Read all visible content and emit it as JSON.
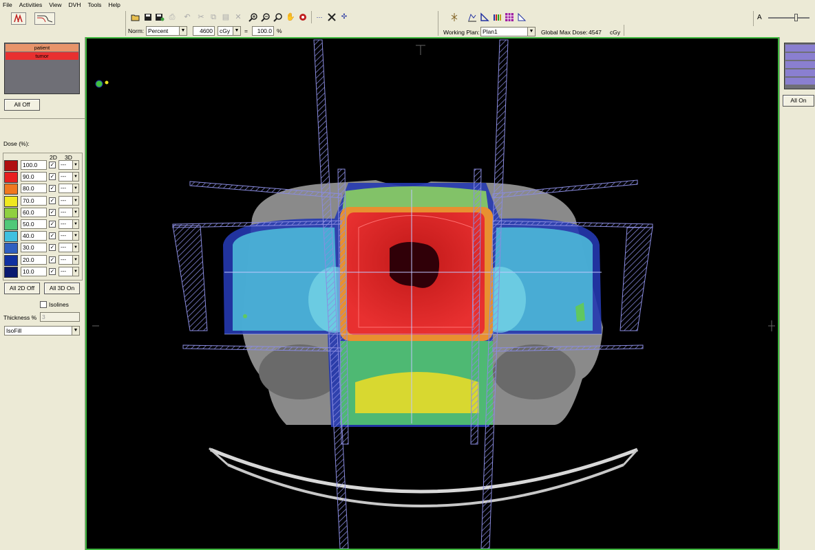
{
  "menu": [
    "File",
    "Activities",
    "View",
    "DVH",
    "Tools",
    "Help"
  ],
  "toolbar": {
    "norm_label": "Norm:",
    "norm_mode": "Percent",
    "norm_dose": "4600",
    "norm_unit": "cGy",
    "equals": "=",
    "norm_percent": "100.0",
    "percent_sign": "%",
    "working_plan_label": "Working Plan:",
    "working_plan": "Plan1",
    "global_max_label": "Global Max Dose:",
    "global_max_value": "4547",
    "global_max_unit": "cGy",
    "slider_label": "A"
  },
  "structures": {
    "items": [
      {
        "label": "patient",
        "color": "#e8946a"
      },
      {
        "label": "tumor",
        "color": "#e83030"
      }
    ],
    "all_off_label": "All Off"
  },
  "dose": {
    "title": "Dose (%):",
    "col_2d": "2D",
    "col_3d": "3D",
    "levels": [
      {
        "value": "100.0",
        "color": "#b01010",
        "mode_3d": "---"
      },
      {
        "value": "90.0",
        "color": "#e82020",
        "mode_3d": "---"
      },
      {
        "value": "80.0",
        "color": "#f07820",
        "mode_3d": "---"
      },
      {
        "value": "70.0",
        "color": "#f0e820",
        "mode_3d": "---"
      },
      {
        "value": "60.0",
        "color": "#90d040",
        "mode_3d": "---"
      },
      {
        "value": "50.0",
        "color": "#50c878",
        "mode_3d": "---"
      },
      {
        "value": "40.0",
        "color": "#40c0e0",
        "mode_3d": "---"
      },
      {
        "value": "30.0",
        "color": "#3060c0",
        "mode_3d": "---"
      },
      {
        "value": "20.0",
        "color": "#1030a0",
        "mode_3d": "---"
      },
      {
        "value": "10.0",
        "color": "#0a1a70",
        "mode_3d": "---"
      }
    ],
    "all_2d_off_label": "All 2D Off",
    "all_3d_on_label": "All 3D On",
    "isolines_label": "Isolines",
    "thickness_label": "Thickness %",
    "thickness_value": "3",
    "render_mode": "IsoFill"
  },
  "right_panel": {
    "all_on_label": "All On",
    "swatches": [
      "#8a7fd0",
      "#8a7fd0",
      "#8a7fd0",
      "#8a7fd0",
      "#8a7fd0"
    ]
  },
  "colors": {
    "viewport_border": "#3fb83f",
    "panel_bg": "#ecead6",
    "beam": "#8a8ce0"
  }
}
